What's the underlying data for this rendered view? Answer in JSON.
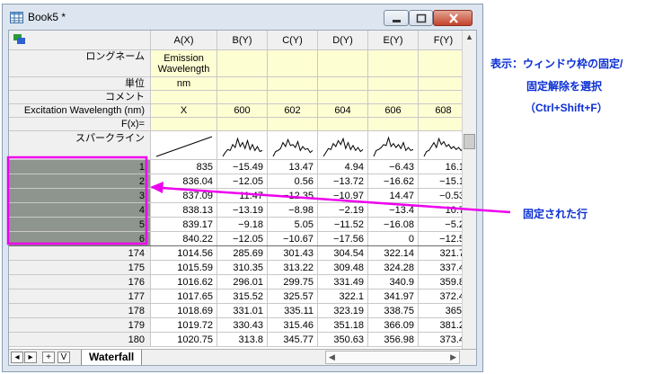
{
  "window": {
    "title": "Book5 *",
    "icon": "worksheet-icon"
  },
  "title_buttons": {
    "minimize": "minimize-icon",
    "maximize": "maximize-icon",
    "close": "close-icon"
  },
  "corner": {
    "icon": "select-all-icon"
  },
  "columns": [
    "A(X)",
    "B(Y)",
    "C(Y)",
    "D(Y)",
    "E(Y)",
    "F(Y)"
  ],
  "label_rows": {
    "long_name": {
      "label": "ロングネーム",
      "values": [
        "Emission\nWavelength",
        "",
        "",
        "",
        "",
        ""
      ]
    },
    "units": {
      "label": "単位",
      "values": [
        "nm",
        "",
        "",
        "",
        "",
        ""
      ]
    },
    "comments": {
      "label": "コメント",
      "values": [
        "",
        "",
        "",
        "",
        "",
        ""
      ]
    },
    "excitation": {
      "label": "Excitation Wavelength (nm)",
      "values": [
        "X",
        "600",
        "602",
        "604",
        "606",
        "608"
      ]
    },
    "fx": {
      "label": "F(x)=",
      "values": [
        "",
        "",
        "",
        "",
        "",
        ""
      ]
    },
    "sparklines": {
      "label": "スパークライン"
    }
  },
  "frozen_rows": [
    {
      "row": "1",
      "cells": [
        "835",
        "−15.49",
        "13.47",
        "4.94",
        "−6.43",
        "16.1"
      ]
    },
    {
      "row": "2",
      "cells": [
        "836.04",
        "−12.05",
        "0.56",
        "−13.72",
        "−16.62",
        "−15.1"
      ]
    },
    {
      "row": "3",
      "cells": [
        "837.09",
        "11.47",
        "−12.35",
        "−10.97",
        "14.47",
        "−0.53"
      ]
    },
    {
      "row": "4",
      "cells": [
        "838.13",
        "−13.19",
        "−8.98",
        "−2.19",
        "−13.4",
        "10.7"
      ]
    },
    {
      "row": "5",
      "cells": [
        "839.17",
        "−9.18",
        "5.05",
        "−11.52",
        "−16.08",
        "−5.2"
      ]
    },
    {
      "row": "6",
      "cells": [
        "840.22",
        "−12.05",
        "−10.67",
        "−17.56",
        "0",
        "−12.5"
      ]
    }
  ],
  "rows": [
    {
      "row": "174",
      "cells": [
        "1014.56",
        "285.69",
        "301.43",
        "304.54",
        "322.14",
        "321.7"
      ]
    },
    {
      "row": "175",
      "cells": [
        "1015.59",
        "310.35",
        "313.22",
        "309.48",
        "324.28",
        "337.4"
      ]
    },
    {
      "row": "176",
      "cells": [
        "1016.62",
        "296.01",
        "299.75",
        "331.49",
        "340.9",
        "359.8"
      ]
    },
    {
      "row": "177",
      "cells": [
        "1017.65",
        "315.52",
        "325.57",
        "322.1",
        "341.97",
        "372.4"
      ]
    },
    {
      "row": "178",
      "cells": [
        "1018.69",
        "331.01",
        "335.11",
        "323.19",
        "338.75",
        "365."
      ]
    },
    {
      "row": "179",
      "cells": [
        "1019.72",
        "330.43",
        "315.46",
        "351.18",
        "366.09",
        "381.2"
      ]
    },
    {
      "row": "180",
      "cells": [
        "1020.75",
        "313.8",
        "345.77",
        "350.63",
        "356.98",
        "373.4"
      ]
    }
  ],
  "sheet": {
    "tab": "Waterfall",
    "nav": [
      "◂",
      "▸",
      "+",
      "V"
    ]
  },
  "annotations": {
    "note_line1": "表示：ウィンドウ枠の固定/",
    "note_line2": "固定解除を選択",
    "note_line3": "（Ctrl+Shift+F）",
    "frozen_label": "固定された行"
  },
  "colors": {
    "highlight": "#ee00ee",
    "note_text": "#0a2fd4",
    "frozen_fill": "#8e958e",
    "label_fill": "#fefed3"
  }
}
